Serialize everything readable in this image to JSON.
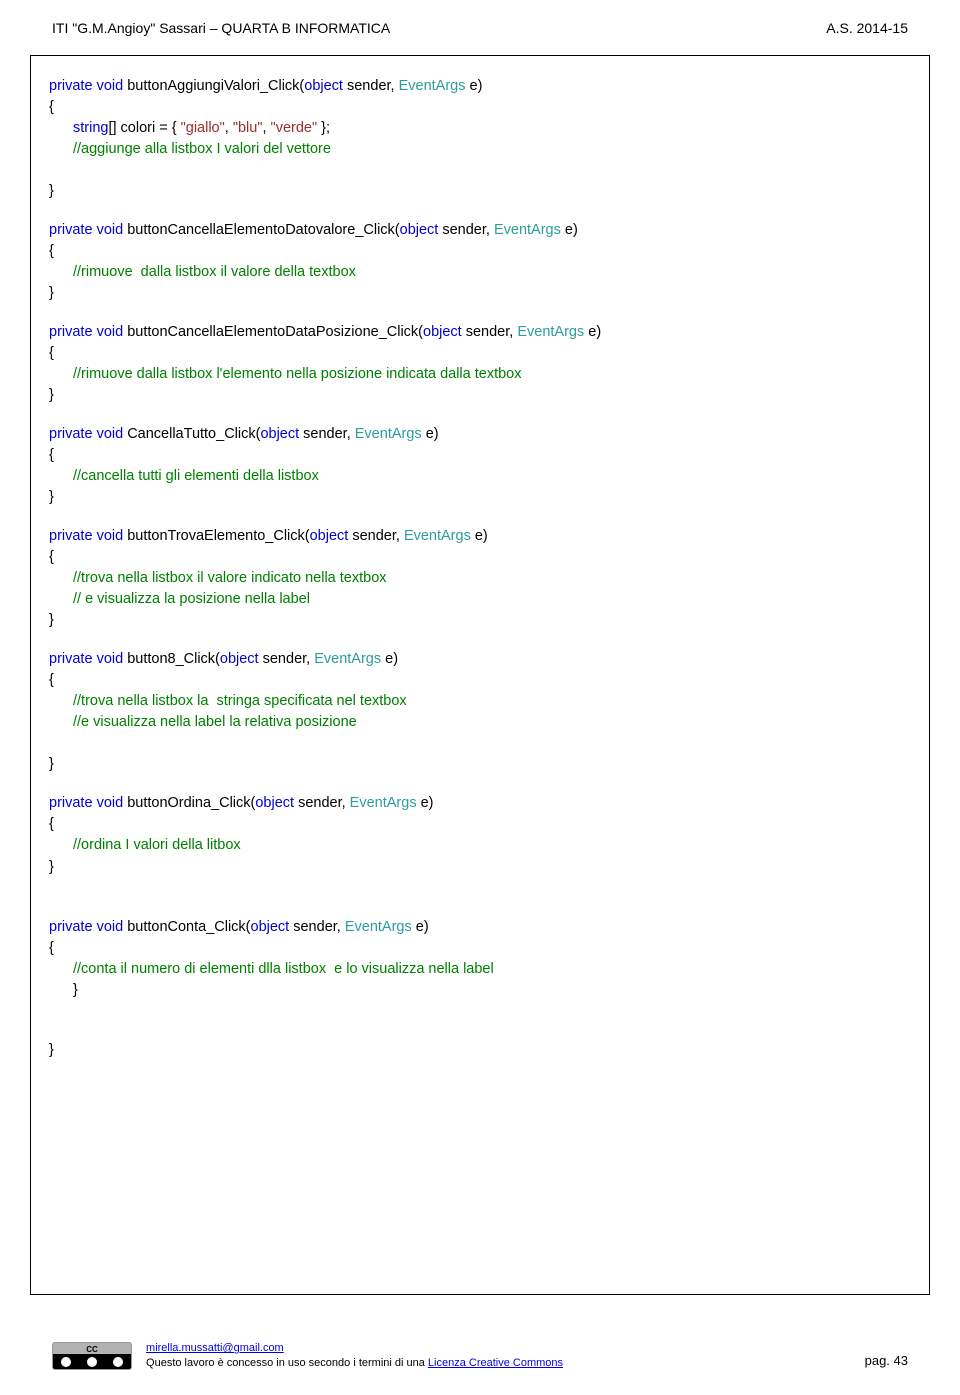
{
  "header": {
    "left": "ITI \"G.M.Angioy\" Sassari – QUARTA B   INFORMATICA",
    "right": "A.S. 2014-15"
  },
  "kw": {
    "private": "private",
    "void": "void",
    "object": "object",
    "string_arr": "string"
  },
  "typ": {
    "EventArgs": "EventArgs"
  },
  "methods": {
    "m1": {
      "name": " buttonAggiungiValori_Click(",
      "sig_tail": " sender, ",
      "sig_end": " e)",
      "l1a": "[] colori = { ",
      "l1b": ", ",
      "l1c": ", ",
      "l1d": " };",
      "s_giallo": "\"giallo\"",
      "s_blu": "\"blu\"",
      "s_verde": "\"verde\"",
      "c1": "//aggiunge alla listbox I valori del vettore"
    },
    "m2": {
      "name": " buttonCancellaElementoDatovalore_Click(",
      "c1": "//rimuove  dalla listbox il valore della textbox"
    },
    "m3": {
      "name": " buttonCancellaElementoDataPosizione_Click(",
      "c1": "//rimuove dalla listbox l'elemento nella posizione indicata dalla textbox"
    },
    "m4": {
      "name": " CancellaTutto_Click(",
      "c1": "//cancella tutti gli elementi della listbox"
    },
    "m5": {
      "name": " buttonTrovaElemento_Click(",
      "c1": "//trova nella listbox il valore indicato nella textbox",
      "c2": "// e visualizza la posizione nella label"
    },
    "m6": {
      "name": " button8_Click(",
      "c1": "//trova nella listbox la  stringa specificata nel textbox",
      "c2": "//e visualizza nella label la relativa posizione"
    },
    "m7": {
      "name": " buttonOrdina_Click(",
      "c1": "//ordina I valori della litbox"
    },
    "m8": {
      "name": " buttonConta_Click(",
      "c1": "//conta il numero di elementi dlla listbox  e lo visualizza nella label"
    }
  },
  "braces": {
    "open": "{",
    "close": "}"
  },
  "footer": {
    "cc_label": "CC",
    "email": "mirella.mussatti@gmail.com",
    "license_prefix": "Questo lavoro è concesso in uso secondo i termini di una  ",
    "license_link": "Licenza Creative Commons",
    "page_label": "pag.  ",
    "page_num": "43"
  }
}
